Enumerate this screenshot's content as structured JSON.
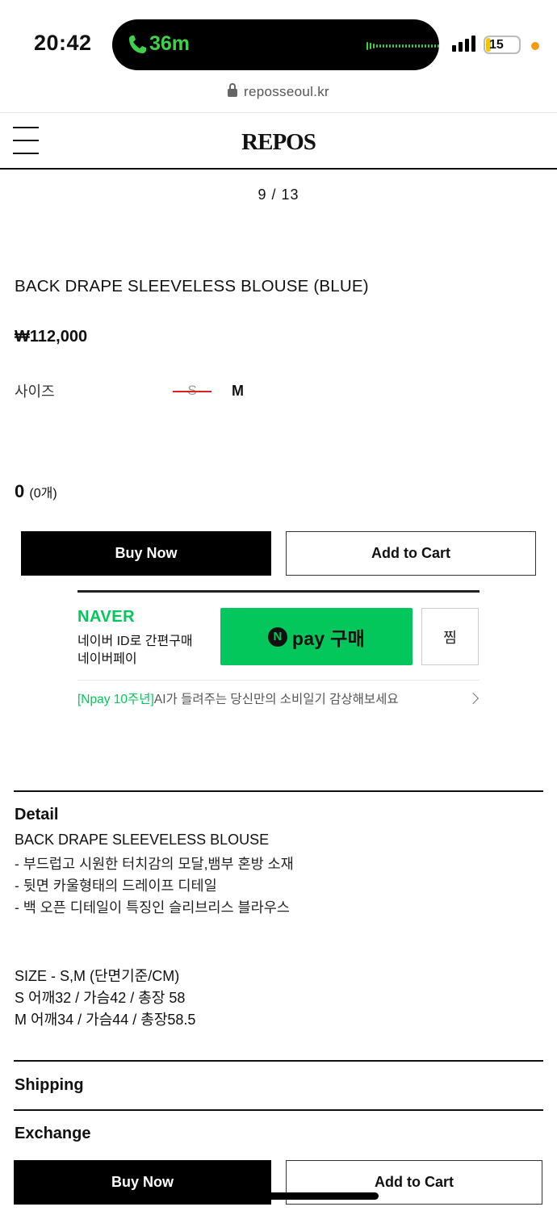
{
  "status_bar": {
    "time": "20:42",
    "call_duration": "36m",
    "battery": "15",
    "battery_level_percent": 15,
    "accent_green": "#3fd14a"
  },
  "browser": {
    "url": "reposseoul.kr"
  },
  "header": {
    "logo": "REPOS",
    "menu_icon": "hamburger-icon"
  },
  "gallery": {
    "counter": "9 / 13"
  },
  "product": {
    "title": "BACK DRAPE SLEEVELESS BLOUSE (BLUE)",
    "price": "₩112,000",
    "size_label": "사이즈",
    "sizes": [
      {
        "label": "S",
        "sold_out": true
      },
      {
        "label": "M",
        "sold_out": false
      }
    ],
    "total": "0",
    "total_count": "(0개)"
  },
  "actions": {
    "buy_now": "Buy Now",
    "add_to_cart": "Add to Cart"
  },
  "naver_pay": {
    "logo": "NAVER",
    "sub1": "네이버 ID로 간편구매",
    "sub2": "네이버페이",
    "pay_label": "pay 구매",
    "n_mark": "N",
    "zzim": "찜",
    "promo_highlight": "[Npay 10주년]",
    "promo_text": "AI가 들려주는 당신만의 소비일기 감상해보세요",
    "brand_color": "#03c75a"
  },
  "detail": {
    "heading": "Detail",
    "lines": [
      "BACK DRAPE SLEEVELESS BLOUSE",
      "- 부드럽고 시원한 터치감의 모달,뱀부 혼방 소재",
      "- 뒷면 카울형태의 드레이프 디테일",
      "- 백 오픈 디테일이 특징인 슬리브리스 블라우스"
    ],
    "size_lines": [
      "SIZE - S,M (단면기준/CM)",
      "S 어깨32 / 가슴42 / 총장 58",
      "M 어깨34 / 가슴44 / 총장58.5"
    ]
  },
  "sections": {
    "shipping": "Shipping",
    "exchange": "Exchange"
  },
  "sticky_actions": {
    "buy_now": "Buy Now",
    "add_to_cart": "Add to Cart"
  }
}
